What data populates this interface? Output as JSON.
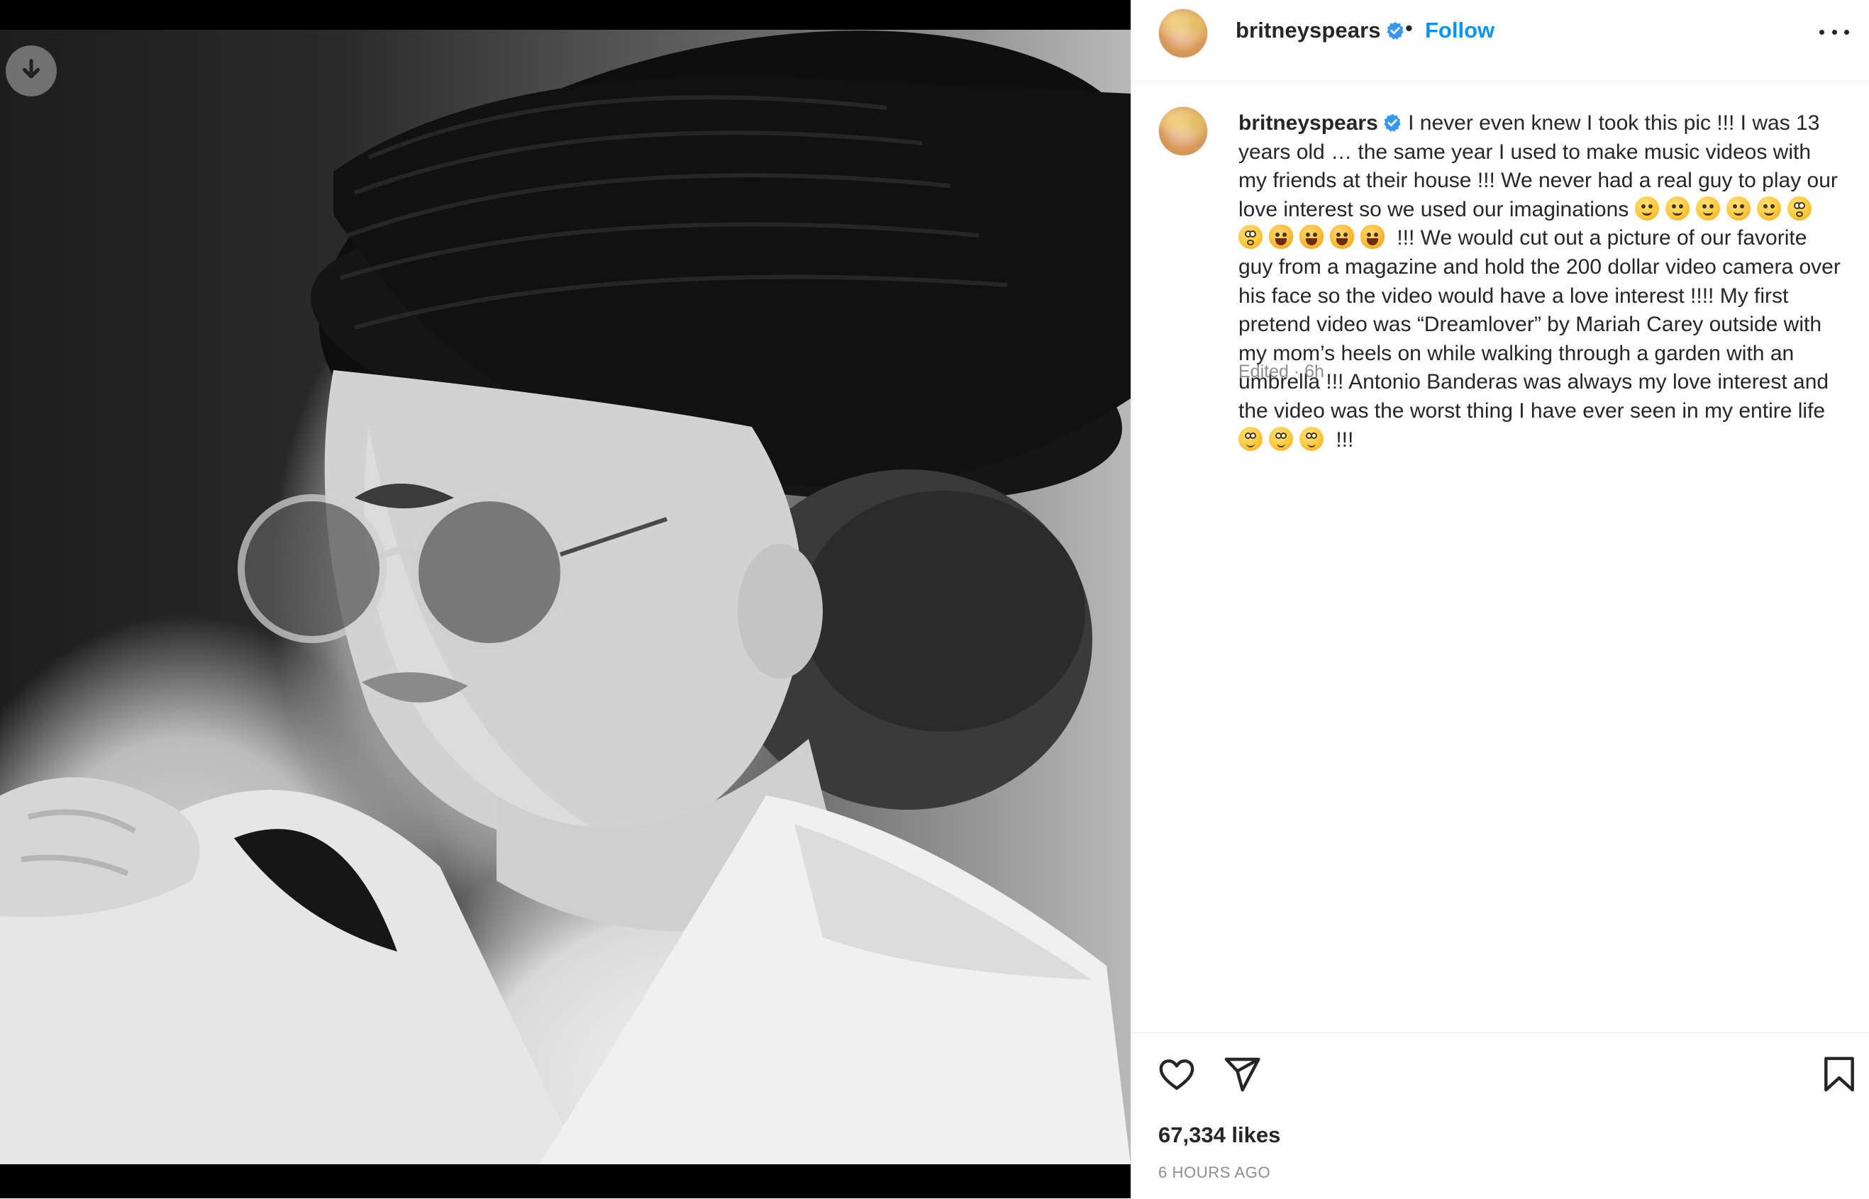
{
  "post": {
    "username": "britneyspears",
    "verified": true,
    "follow_label": "Follow",
    "separator": "•",
    "more_icon": "more-options-icon",
    "media": {
      "download_icon": "download-icon"
    },
    "caption": {
      "segments": [
        "I never even knew I took this pic !!! I was 13 years old … the same year I used to make music videos with my friends at their house !!! We never had a real guy to play our love interest so we used our imaginations",
        "!!! We would cut out a picture of our favorite guy from a magazine and hold the 200 dollar video camera over his face so the video would have a love interest !!!! My first pretend video was “Dreamlover” by Mariah Carey outside with my mom’s heels on while walking through a garden with an umbrella !!! Antonio Banderas was always my love interest and the video was the worst thing I have ever seen in my entire life",
        "!!!"
      ],
      "emoji_group_1": [
        "smirk",
        "smirk",
        "smirk",
        "smirk",
        "smirk",
        "dizzy",
        "dizzy",
        "cat-joy",
        "cat-joy",
        "cat-joy",
        "cat-joy"
      ],
      "emoji_group_2": [
        "eye-roll",
        "eye-roll",
        "eye-roll"
      ]
    },
    "edited_label": "Edited · 6h",
    "likes": "67,334 likes",
    "timestamp": "6 HOURS AGO",
    "actions": {
      "like_icon": "heart-icon",
      "share_icon": "send-icon",
      "save_icon": "bookmark-icon"
    }
  },
  "colors": {
    "accent": "#0095f6",
    "text": "#262626",
    "muted": "#8e8e8e",
    "border": "#efefef"
  }
}
